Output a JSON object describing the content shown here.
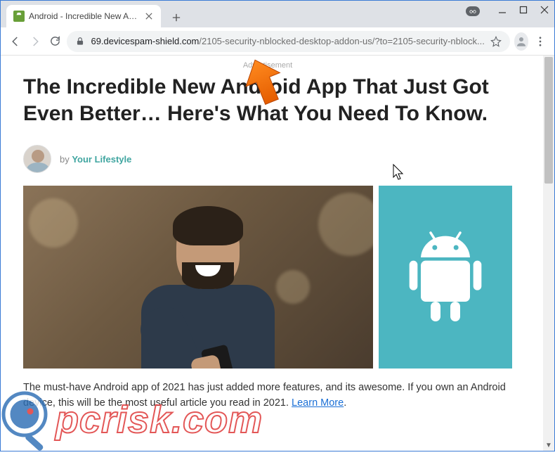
{
  "window": {
    "tab_title": "Android - Incredible New App - I",
    "incognito": true
  },
  "toolbar": {
    "url_domain": "69.devicespam-shield.com",
    "url_path": "/2105-security-nblocked-desktop-addon-us/?to=2105-security-nblock..."
  },
  "page": {
    "ad_label": "Advertisement",
    "headline": "The Incredible New Android App That Just Got Even Better… Here's What You Need To Know.",
    "byline_prefix": "by ",
    "byline_author": "Your Lifestyle",
    "body_part1": "The must-have Android app of 2021 has just added more features, and its awesome. If you own an Android device, this will be the most useful article you read in 2021. ",
    "learn_more": "Learn More",
    "body_period": "."
  },
  "icons": {
    "android": "android-icon"
  },
  "watermark": {
    "text": "pcrisk.com"
  }
}
